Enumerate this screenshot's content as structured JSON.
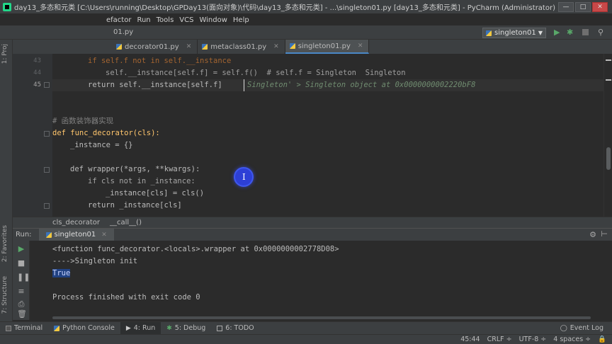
{
  "window": {
    "title": "day13_多态和元类 [C:\\Users\\running\\Desktop\\GPDay13(面向对象)\\代码\\day13_多态和元类] - ...\\singleton01.py [day13_多态和元类] - PyCharm (Administrator)",
    "minimize": "—",
    "maximize": "□",
    "close": "✕"
  },
  "menu": {
    "items": [
      "efactor",
      "Run",
      "Tools",
      "VCS",
      "Window",
      "Help"
    ]
  },
  "navbar": {
    "file": "01.py",
    "run_config": "singleton01",
    "run_icon": "▶",
    "debug_icon": "✱",
    "search_icon": "⚲"
  },
  "tabs": [
    {
      "label": "decorator01.py"
    },
    {
      "label": "metaclass01.py"
    },
    {
      "label": "singleton01.py"
    }
  ],
  "left_strip": {
    "project": "1: Proj",
    "favorites": "2: Favorites",
    "structure": "7: Structure"
  },
  "editor": {
    "lines": [
      {
        "num": "43",
        "text": "if self.f not in self.__instance"
      },
      {
        "num": "44",
        "text": "self.__instance[self.f] = self.f()  # self.f = Singleton  Singleton"
      },
      {
        "num": "45",
        "text": "return self.__instance[self.f]"
      },
      {
        "num": "45_hint",
        "text": "Singleton' > Singleton object at 0x0000000002220bF8"
      },
      {
        "num": "",
        "text": ""
      },
      {
        "num": "",
        "text": "# 函数装饰器实现"
      },
      {
        "num": "",
        "text": "def func_decorator(cls):"
      },
      {
        "num": "",
        "text": "_instance = {}"
      },
      {
        "num": "",
        "text": ""
      },
      {
        "num": "",
        "text": "def wrapper(*args, **kwargs):"
      },
      {
        "num": "",
        "text": "if cls not in _instance:"
      },
      {
        "num": "",
        "text": "_instance[cls] = cls()"
      },
      {
        "num": "",
        "text": "return _instance[cls]"
      }
    ],
    "line_numbers": [
      "43",
      "44",
      "45"
    ]
  },
  "breadcrumb": {
    "items": [
      "cls_decorator",
      "__call__()"
    ]
  },
  "run": {
    "label": "Run:",
    "tab": "singleton01",
    "output": [
      "<function func_decorator.<locals>.wrapper at 0x0000000002778D08>",
      "---->Singleton init",
      "True",
      "",
      "Process finished with exit code 0"
    ]
  },
  "tool_tabs": [
    {
      "label": "Terminal"
    },
    {
      "label": "Python Console"
    },
    {
      "label": "4: Run"
    },
    {
      "label": "5: Debug"
    },
    {
      "label": "6: TODO"
    }
  ],
  "event_log": "Event Log",
  "status": {
    "position": "45:44",
    "line_sep": "CRLF ÷",
    "encoding": "UTF-8 ÷",
    "indent": "4 spaces ÷"
  }
}
